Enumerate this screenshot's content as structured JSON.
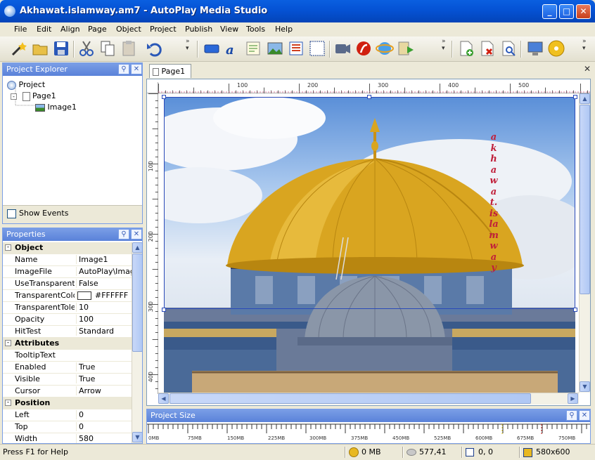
{
  "window": {
    "title": "Akhawat.islamway.am7 - AutoPlay Media Studio"
  },
  "menu": [
    "File",
    "Edit",
    "Align",
    "Page",
    "Object",
    "Project",
    "Publish",
    "View",
    "Tools",
    "Help"
  ],
  "explorer": {
    "title": "Project Explorer",
    "tree": {
      "root": "Project",
      "page": "Page1",
      "image": "Image1"
    },
    "show_events": "Show Events"
  },
  "properties": {
    "title": "Properties",
    "groups": [
      {
        "name": "Object",
        "rows": [
          {
            "name": "Name",
            "value": "Image1"
          },
          {
            "name": "ImageFile",
            "value": "AutoPlay\\Image"
          },
          {
            "name": "UseTransparentC",
            "value": "False"
          },
          {
            "name": "TransparentColor",
            "value": "#FFFFFF"
          },
          {
            "name": "TransparentToler",
            "value": "10"
          },
          {
            "name": "Opacity",
            "value": "100"
          },
          {
            "name": "HitTest",
            "value": "Standard"
          }
        ]
      },
      {
        "name": "Attributes",
        "rows": [
          {
            "name": "TooltipText",
            "value": ""
          },
          {
            "name": "Enabled",
            "value": "True"
          },
          {
            "name": "Visible",
            "value": "True"
          },
          {
            "name": "Cursor",
            "value": "Arrow"
          }
        ]
      },
      {
        "name": "Position",
        "rows": [
          {
            "name": "Left",
            "value": "0"
          },
          {
            "name": "Top",
            "value": "0"
          },
          {
            "name": "Width",
            "value": "580"
          }
        ]
      }
    ]
  },
  "editor": {
    "tab": "Page1",
    "hruler": [
      "100",
      "200",
      "300",
      "400",
      "500"
    ],
    "vruler": [
      "100",
      "200",
      "300",
      "400"
    ],
    "watermark": "akhawat.islamway"
  },
  "project_size": {
    "title": "Project Size",
    "ticks": [
      "0MB",
      "75MB",
      "150MB",
      "225MB",
      "300MB",
      "375MB",
      "450MB",
      "525MB",
      "600MB",
      "675MB",
      "750MB"
    ]
  },
  "status": {
    "help": "Press F1 for Help",
    "size": "0 MB",
    "cursor_pos": "577,41",
    "sel_pos": "0, 0",
    "page_size": "580x600"
  },
  "colors": {
    "accent": "#0552d4",
    "panel_header": "#6a8fe0",
    "watermark": "#c0203a"
  }
}
